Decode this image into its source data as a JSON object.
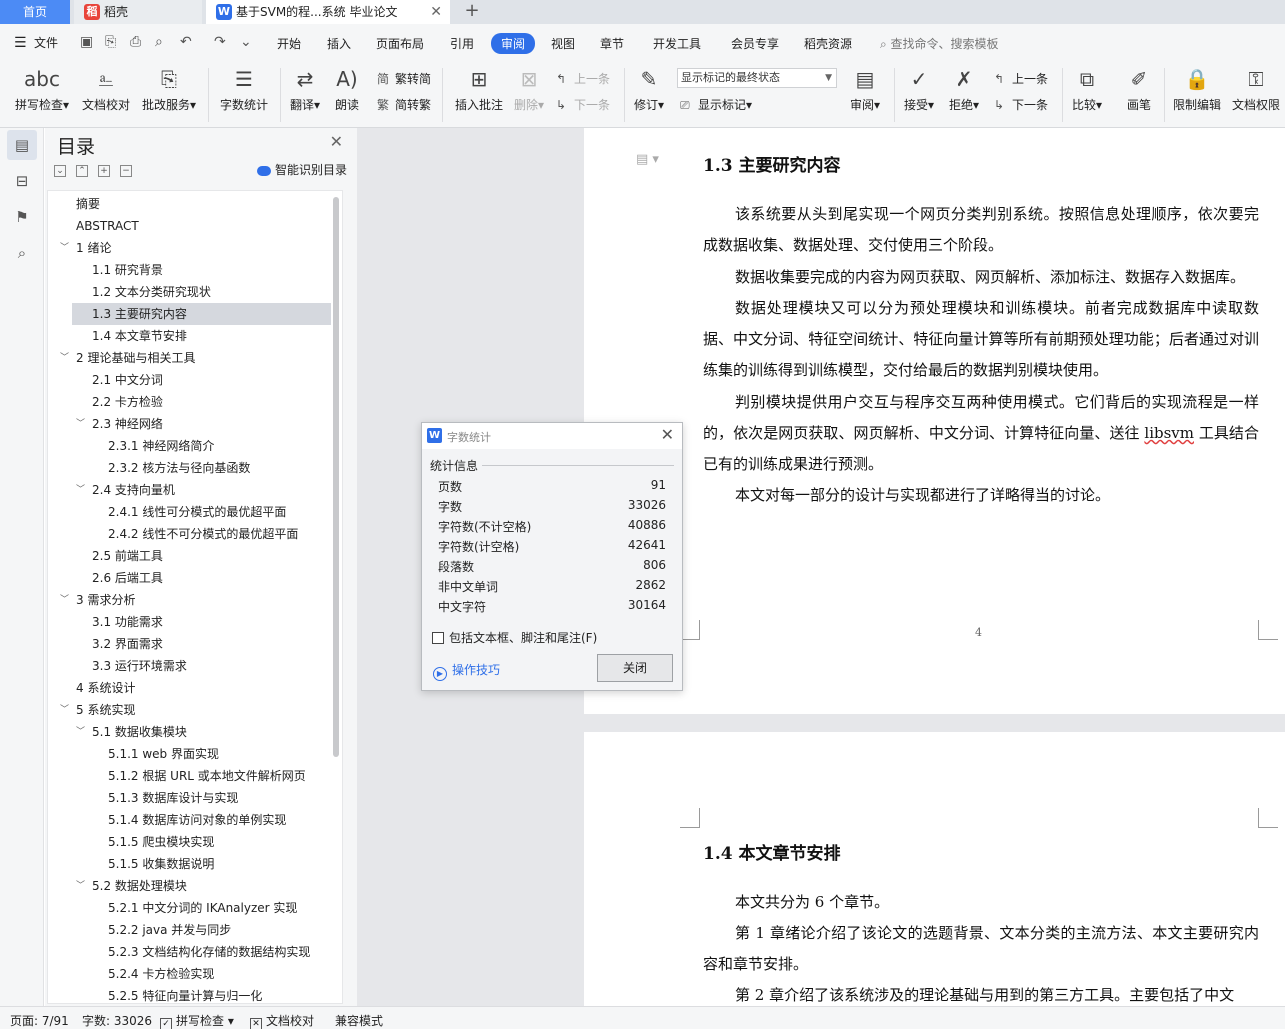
{
  "tabs": {
    "home": "首页",
    "daoke": "稻壳",
    "doc": "基于SVM的程...系统 毕业论文"
  },
  "menu": {
    "file": "文件",
    "items": [
      "开始",
      "插入",
      "页面布局",
      "引用",
      "审阅",
      "视图",
      "章节",
      "开发工具",
      "会员专享",
      "稻壳资源"
    ],
    "active": "审阅",
    "search_placeholder": "查找命令、搜索模板"
  },
  "ribbon": {
    "spell_check": "拼写检查",
    "doc_proofread": "文档校对",
    "batch_service": "批改服务",
    "word_count": "字数统计",
    "translate": "翻译",
    "read_aloud": "朗读",
    "trad_to_simp": "繁转简",
    "simp_to_trad": "简转繁",
    "insert_comment": "插入批注",
    "delete": "删除",
    "prev_comment": "上一条",
    "next_comment": "下一条",
    "revise": "修订",
    "display_state": "显示标记的最终状态",
    "show_markup": "显示标记",
    "review": "审阅",
    "accept": "接受",
    "reject": "拒绝",
    "prev_change": "上一条",
    "next_change": "下一条",
    "compare": "比较",
    "pen": "画笔",
    "restrict_edit": "限制编辑",
    "doc_permission": "文档权限"
  },
  "toc": {
    "title": "目录",
    "ai_label": "智能识别目录",
    "items": [
      {
        "text": "摘要",
        "level": 0,
        "exp": ""
      },
      {
        "text": "ABSTRACT",
        "level": 0,
        "exp": ""
      },
      {
        "text": "1 绪论",
        "level": 0,
        "exp": "v"
      },
      {
        "text": "1.1  研究背景",
        "level": 1,
        "exp": ""
      },
      {
        "text": "1.2  文本分类研究现状",
        "level": 1,
        "exp": ""
      },
      {
        "text": "1.3  主要研究内容",
        "level": 1,
        "exp": "",
        "selected": true
      },
      {
        "text": "1.4  本文章节安排",
        "level": 1,
        "exp": ""
      },
      {
        "text": "2 理论基础与相关工具",
        "level": 0,
        "exp": "v"
      },
      {
        "text": "2.1  中文分词",
        "level": 1,
        "exp": ""
      },
      {
        "text": "2.2  卡方检验",
        "level": 1,
        "exp": ""
      },
      {
        "text": "2.3  神经网络",
        "level": 1,
        "exp": "v"
      },
      {
        "text": "2.3.1  神经网络简介",
        "level": 2,
        "exp": ""
      },
      {
        "text": "2.3.2 核方法与径向基函数",
        "level": 2,
        "exp": ""
      },
      {
        "text": "2.4  支持向量机",
        "level": 1,
        "exp": "v"
      },
      {
        "text": "2.4.1 线性可分模式的最优超平面",
        "level": 2,
        "exp": ""
      },
      {
        "text": "2.4.2 线性不可分模式的最优超平面",
        "level": 2,
        "exp": ""
      },
      {
        "text": "2.5  前端工具",
        "level": 1,
        "exp": ""
      },
      {
        "text": "2.6  后端工具",
        "level": 1,
        "exp": ""
      },
      {
        "text": "3 需求分析",
        "level": 0,
        "exp": "v"
      },
      {
        "text": "3.1  功能需求",
        "level": 1,
        "exp": ""
      },
      {
        "text": "3.2  界面需求",
        "level": 1,
        "exp": ""
      },
      {
        "text": "3.3 运行环境需求",
        "level": 1,
        "exp": ""
      },
      {
        "text": "4 系统设计",
        "level": 0,
        "exp": ""
      },
      {
        "text": "5 系统实现",
        "level": 0,
        "exp": "v"
      },
      {
        "text": "5.1  数据收集模块",
        "level": 1,
        "exp": "v"
      },
      {
        "text": "5.1.1 web  界面实现",
        "level": 2,
        "exp": ""
      },
      {
        "text": "5.1.2  根据 URL 或本地文件解析网页",
        "level": 2,
        "exp": ""
      },
      {
        "text": "5.1.3  数据库设计与实现",
        "level": 2,
        "exp": ""
      },
      {
        "text": "5.1.4  数据库访问对象的单例实现",
        "level": 2,
        "exp": ""
      },
      {
        "text": "5.1.5  爬虫模块实现",
        "level": 2,
        "exp": ""
      },
      {
        "text": "5.1.5  收集数据说明",
        "level": 2,
        "exp": ""
      },
      {
        "text": "5.2  数据处理模块",
        "level": 1,
        "exp": "v"
      },
      {
        "text": "5.2.1 中文分词的 IKAnalyzer 实现",
        "level": 2,
        "exp": ""
      },
      {
        "text": "5.2.2 java  并发与同步",
        "level": 2,
        "exp": ""
      },
      {
        "text": "5.2.3  文档结构化存储的数据结构实现",
        "level": 2,
        "exp": ""
      },
      {
        "text": "5.2.4 卡方检验实现",
        "level": 2,
        "exp": ""
      },
      {
        "text": "5.2.5  特征向量计算与归一化",
        "level": 2,
        "exp": ""
      }
    ]
  },
  "doc": {
    "h_13": "1.3  主要研究内容",
    "p1": "该系统要从头到尾实现一个网页分类判别系统。按照信息处理顺序，依次要完成数据收集、数据处理、交付使用三个阶段。",
    "p2": "数据收集要完成的内容为网页获取、网页解析、添加标注、数据存入数据库。",
    "p3": "数据处理模块又可以分为预处理模块和训练模块。前者完成数据库中读取数据、中文分词、特征空间统计、特征向量计算等所有前期预处理功能；后者通过对训练集的训练得到训练模型，交付给最后的数据判别模块使用。",
    "p4a": "判别模块提供用户交互与程序交互两种使用模式。它们背后的实现流程是一样的，依次是网页获取、网页解析、中文分词、计算特征向量、送往 ",
    "p4b": "libsvm",
    "p4c": " 工具结合已有的训练成果进行预测。",
    "p5": "本文对每一部分的设计与实现都进行了详略得当的讨论。",
    "page_number": "4",
    "h_14": "1.4  本文章节安排",
    "p6": "本文共分为 6 个章节。",
    "p7": "第 1 章绪论介绍了该论文的选题背景、文本分类的主流方法、本文主要研究内容和章节安排。",
    "p8": "第 2 章介绍了该系统涉及的理论基础与用到的第三方工具。主要包括了中文"
  },
  "dialog": {
    "title": "字数统计",
    "section": "统计信息",
    "rows": [
      {
        "label": "页数",
        "value": "91"
      },
      {
        "label": "字数",
        "value": "33026"
      },
      {
        "label": "字符数(不计空格)",
        "value": "40886"
      },
      {
        "label": "字符数(计空格)",
        "value": "42641"
      },
      {
        "label": "段落数",
        "value": "806"
      },
      {
        "label": "非中文单词",
        "value": "2862"
      },
      {
        "label": "中文字符",
        "value": "30164"
      }
    ],
    "checkbox": "包括文本框、脚注和尾注(F)",
    "tips": "操作技巧",
    "close": "关闭"
  },
  "status": {
    "page": "页面: 7/91",
    "words": "字数: 33026",
    "spell": "拼写检查",
    "proof": "文档校对",
    "compat": "兼容模式"
  },
  "colors": {
    "accent": "#2f6fe8",
    "home_tab": "#4c8bf5",
    "daoke_badge": "#e8443a"
  }
}
